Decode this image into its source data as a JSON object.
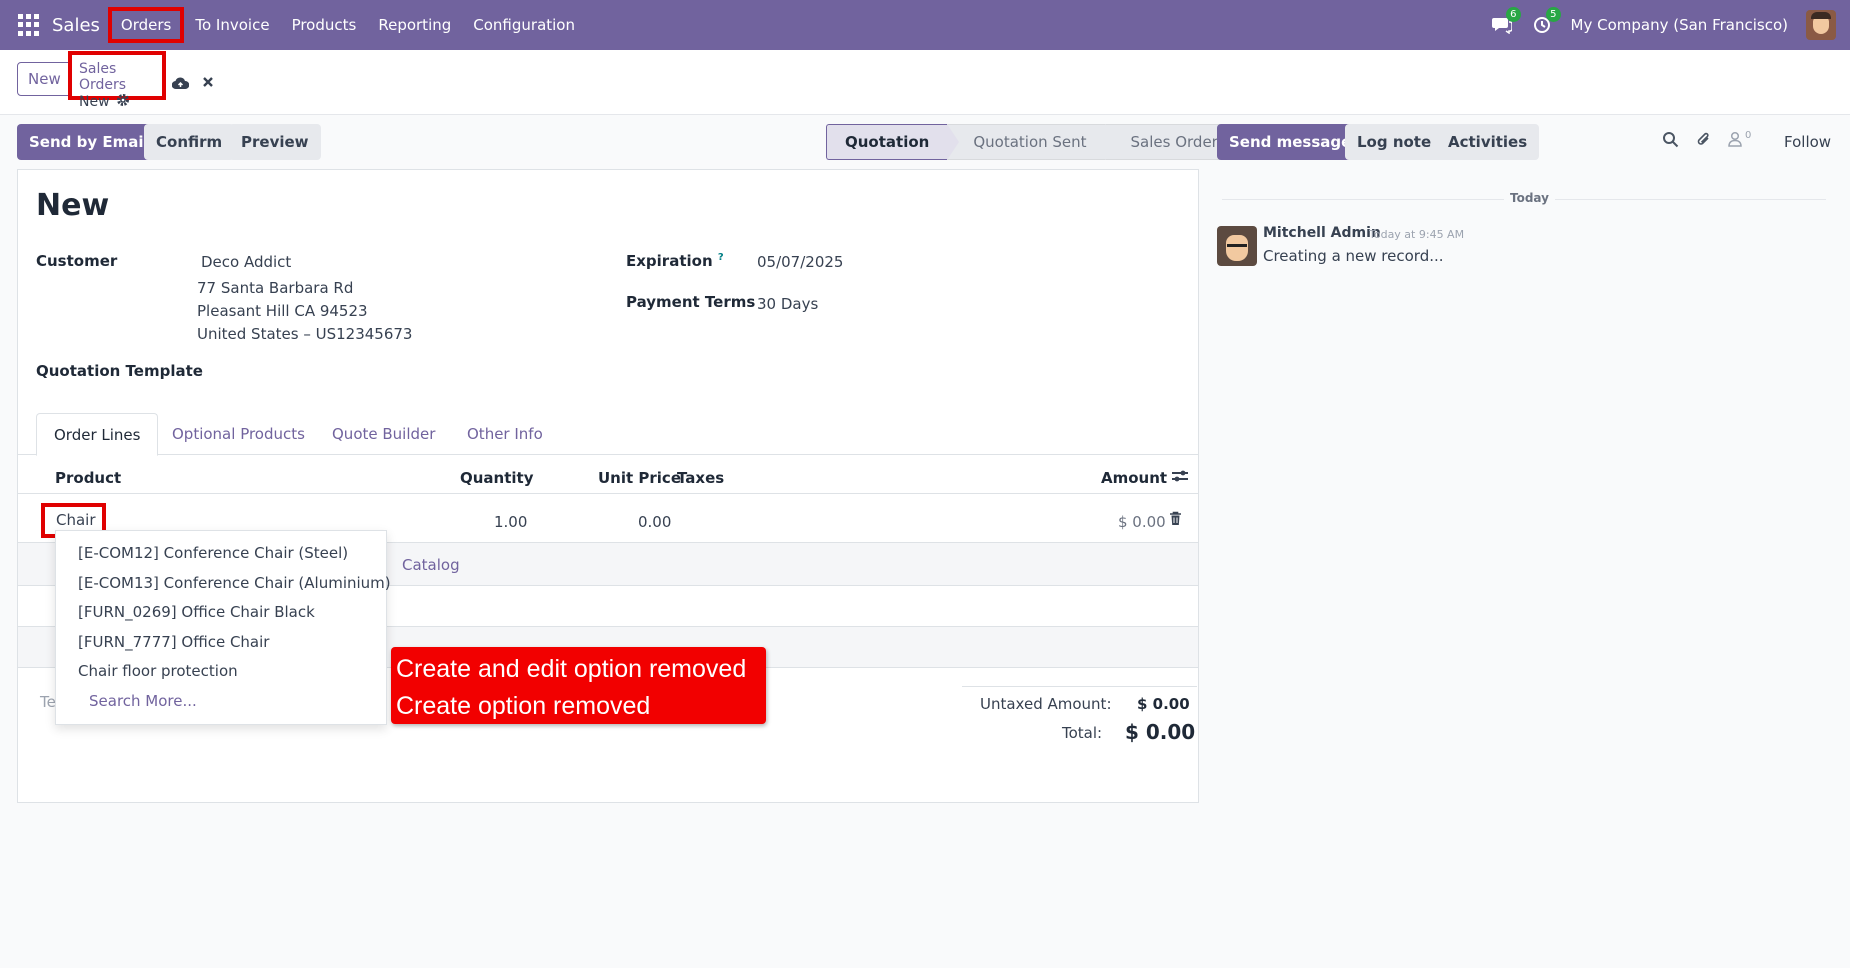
{
  "navbar": {
    "app_name": "Sales",
    "menu": [
      "Orders",
      "To Invoice",
      "Products",
      "Reporting",
      "Configuration"
    ],
    "messages_count": "6",
    "activities_count": "5",
    "company": "My Company (San Francisco)"
  },
  "control_panel": {
    "new_label": "New",
    "breadcrumb_parent": "Sales Orders",
    "breadcrumb_current": "New"
  },
  "actions": {
    "send_email": "Send by Email",
    "confirm": "Confirm",
    "preview": "Preview"
  },
  "statusbar": {
    "stages": [
      "Quotation",
      "Quotation Sent",
      "Sales Order"
    ],
    "active": "Quotation"
  },
  "form": {
    "title": "New",
    "customer_label": "Customer",
    "customer_name": "Deco Addict",
    "address_line1": "77 Santa Barbara Rd",
    "address_line2": "Pleasant Hill CA 94523",
    "address_line3": "United States – US12345673",
    "template_label": "Quotation Template",
    "expiration_label": "Expiration",
    "expiration_help": "?",
    "expiration_value": "05/07/2025",
    "payment_terms_label": "Payment Terms",
    "payment_terms_value": "30 Days"
  },
  "tabs": [
    "Order Lines",
    "Optional Products",
    "Quote Builder",
    "Other Info"
  ],
  "order_lines": {
    "headers": {
      "product": "Product",
      "quantity": "Quantity",
      "unit_price": "Unit Price",
      "taxes": "Taxes",
      "amount": "Amount"
    },
    "row": {
      "product": "Chair",
      "quantity": "1.00",
      "unit_price": "0.00",
      "amount": "$ 0.00"
    },
    "catalog_link": "Catalog",
    "terms_placeholder_fragment": "Te"
  },
  "totals": {
    "untaxed_label": "Untaxed Amount:",
    "untaxed_value": "$ 0.00",
    "total_label": "Total:",
    "total_value": "$ 0.00"
  },
  "autocomplete": {
    "items": [
      "[E-COM12] Conference Chair (Steel)",
      "[E-COM13] Conference Chair (Aluminium)",
      "[FURN_0269] Office Chair Black",
      "[FURN_7777] Office Chair",
      "Chair floor protection"
    ],
    "search_more": "Search More..."
  },
  "annotation": {
    "line1": "Create and edit option removed",
    "line2": "Create option removed",
    "color": "#f20000"
  },
  "chatter": {
    "send_message": "Send message",
    "log_note": "Log note",
    "activities": "Activities",
    "followers_count": "0",
    "follow": "Follow",
    "today": "Today",
    "author": "Mitchell Admin",
    "time": "Today at 9:45 AM",
    "message": "Creating a new record..."
  },
  "colors": {
    "brand": "#71639e",
    "highlight": "#e00000",
    "badge": "#28a745"
  }
}
